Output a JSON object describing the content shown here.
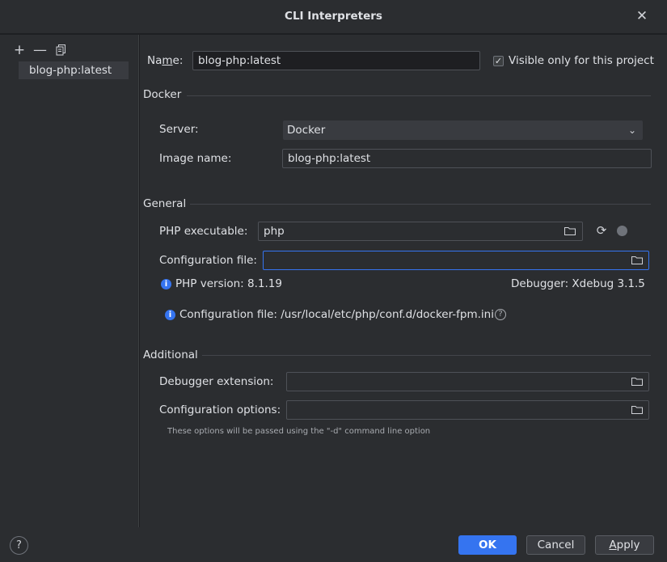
{
  "window": {
    "title": "CLI Interpreters",
    "close_icon": "close-icon"
  },
  "sidebar": {
    "toolbar": [
      "add-icon",
      "remove-icon",
      "copy-icon"
    ],
    "items": [
      {
        "label": "blog-php:latest",
        "selected": true
      }
    ]
  },
  "form": {
    "name_label_prefix": "Na",
    "name_label_mnemonic": "m",
    "name_label_suffix": "e:",
    "name_value": "blog-php:latest",
    "visible_only_label": "Visible only for this project",
    "visible_only_checked": true,
    "docker": {
      "section_title": "Docker",
      "server_label": "Server:",
      "server_value": "Docker",
      "image_label": "Image name:",
      "image_value": "blog-php:latest"
    },
    "general": {
      "section_title": "General",
      "php_exe_label": "PHP executable:",
      "php_exe_value": "php",
      "config_file_label": "Configuration file:",
      "config_file_value": "",
      "php_version": "PHP version: 8.1.19",
      "debugger": "Debugger: Xdebug 3.1.5",
      "config_file_info": "Configuration file: /usr/local/etc/php/conf.d/docker-fpm.ini"
    },
    "additional": {
      "section_title": "Additional",
      "debugger_ext_label": "Debugger extension:",
      "debugger_ext_value": "",
      "config_options_label": "Configuration options:",
      "config_options_value": "",
      "hint": "These options will be passed using the \"-d\" command line option"
    }
  },
  "footer": {
    "help": "?",
    "ok": "OK",
    "cancel": "Cancel",
    "apply_mnemonic": "A",
    "apply_rest": "pply"
  },
  "colors": {
    "accent": "#3574f0",
    "background": "#2b2d30",
    "field_dark": "#1e1f22"
  }
}
